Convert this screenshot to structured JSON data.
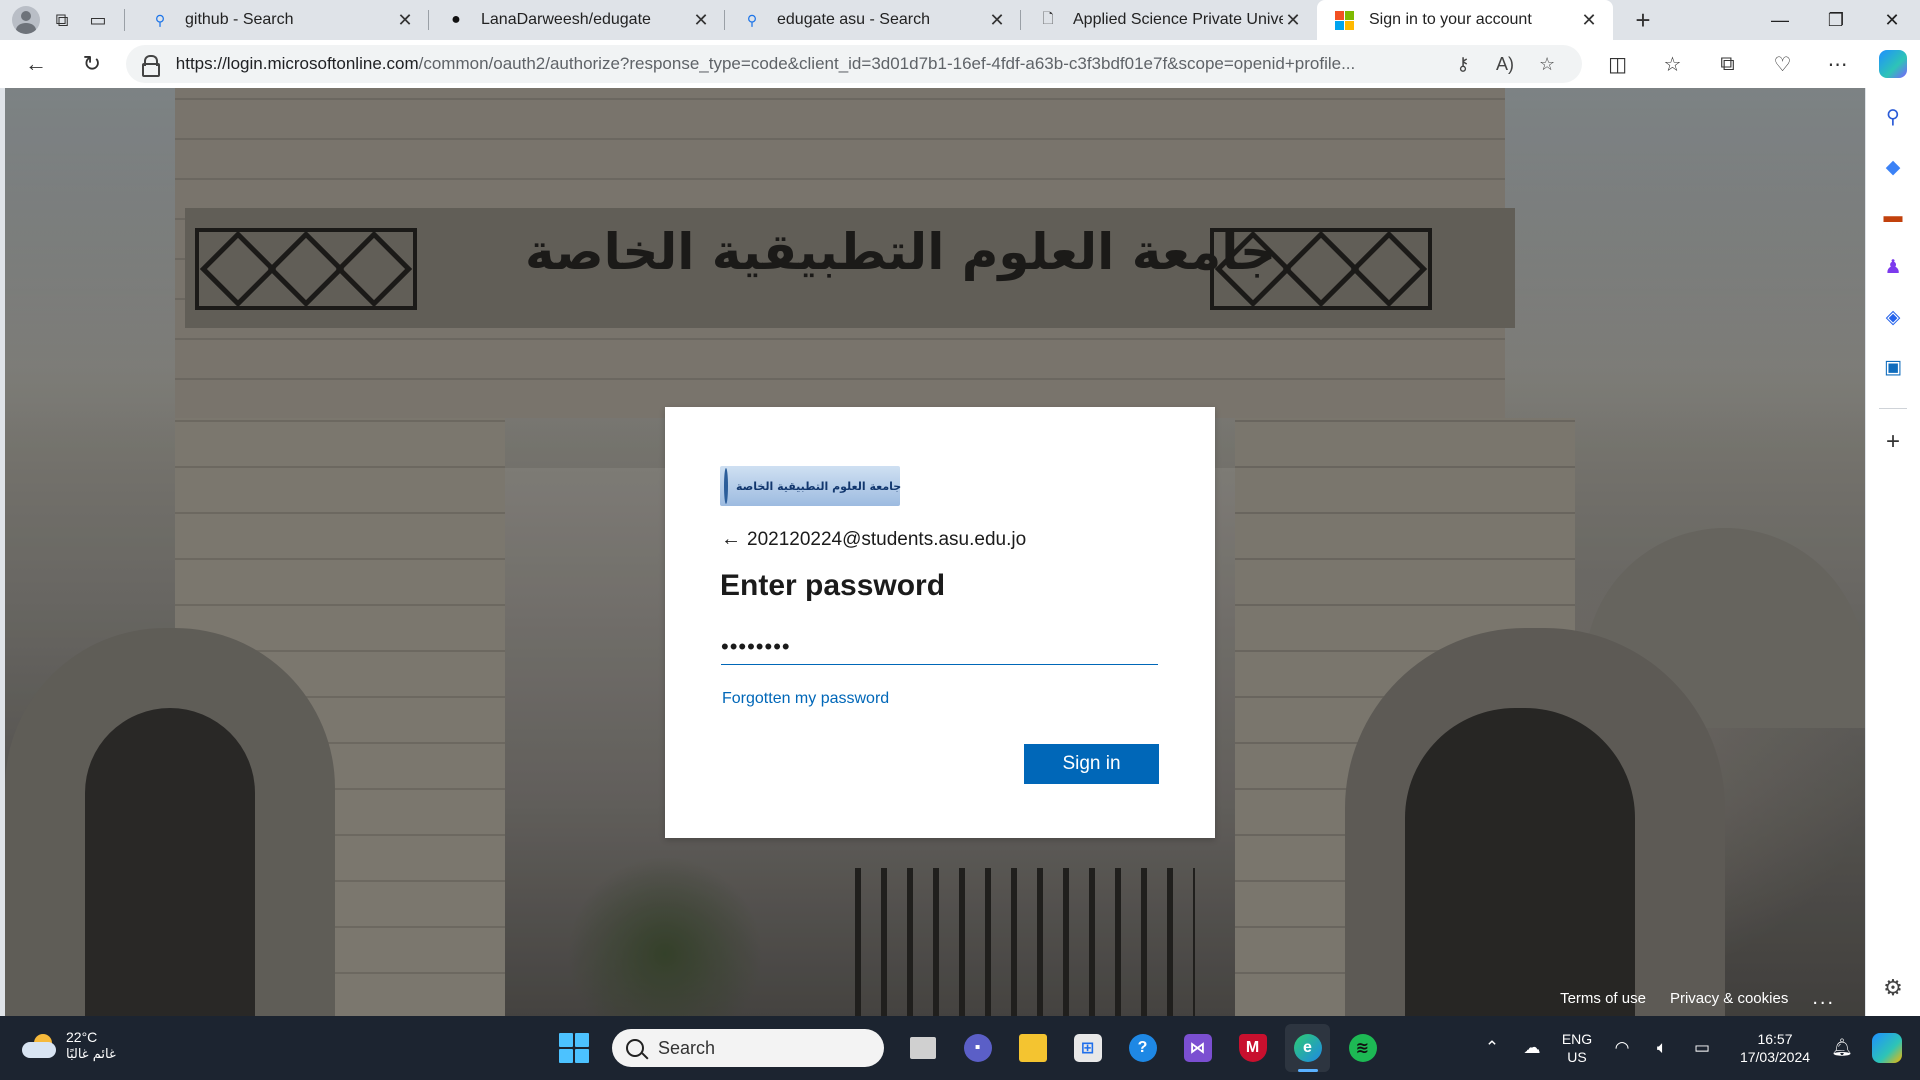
{
  "browser": {
    "tabs": [
      {
        "title": "github - Search",
        "icon": "search-icon"
      },
      {
        "title": "LanaDarweesh/edugate",
        "icon": "github-icon"
      },
      {
        "title": "edugate asu - Search",
        "icon": "search-icon"
      },
      {
        "title": "Applied Science Private Universit",
        "icon": "document-icon"
      },
      {
        "title": "Sign in to your account",
        "icon": "microsoft-icon",
        "active": true
      }
    ],
    "url_host": "https://login.microsoftonline.com",
    "url_path": "/common/oauth2/authorize?response_type=code&client_id=3d01d7b1-16ef-4fdf-a63b-c3f3bdf01e7f&scope=openid+profile..."
  },
  "background": {
    "sign_text": "جامعة العلوم التطبيقية الخاصة"
  },
  "signin": {
    "banner_text": "جامعة العلوم التطبيقية الخاصة",
    "account": "202120224@students.asu.edu.jo",
    "title": "Enter password",
    "password_value": "••••••••",
    "forgot_link": "Forgotten my password",
    "button": "Sign in",
    "footer": {
      "terms": "Terms of use",
      "privacy": "Privacy & cookies",
      "more": "..."
    }
  },
  "taskbar": {
    "temperature": "22°C",
    "condition": "غائم غالبًا",
    "search_placeholder": "Search",
    "lang_top": "ENG",
    "lang_bottom": "US",
    "time": "16:57",
    "date": "17/03/2024"
  },
  "colors": {
    "accent": "#0067b8",
    "taskbar": "#1c2430"
  }
}
